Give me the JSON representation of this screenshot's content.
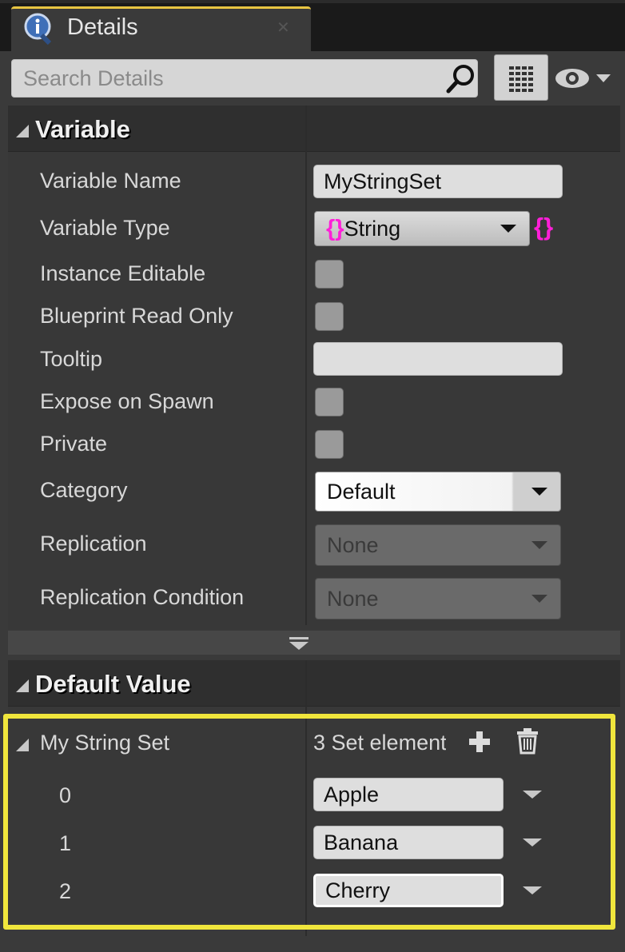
{
  "tab": {
    "title": "Details",
    "icon": "info-icon",
    "close": "✕"
  },
  "search": {
    "placeholder": "Search Details"
  },
  "variable_section": {
    "title": "Variable",
    "rows": {
      "name_label": "Variable Name",
      "name_value": "MyStringSet",
      "type_label": "Variable Type",
      "type_value": "String",
      "type_brace": "{}",
      "instance_editable_label": "Instance Editable",
      "blueprint_read_only_label": "Blueprint Read Only",
      "tooltip_label": "Tooltip",
      "tooltip_value": "",
      "expose_on_spawn_label": "Expose on Spawn",
      "private_label": "Private",
      "category_label": "Category",
      "category_value": "Default",
      "replication_label": "Replication",
      "replication_value": "None",
      "replication_condition_label": "Replication Condition",
      "replication_condition_value": "None"
    }
  },
  "default_value_section": {
    "title": "Default Value",
    "set": {
      "label": "My String Set",
      "count_text": "3 Set element",
      "elements": [
        {
          "index": "0",
          "value": "Apple"
        },
        {
          "index": "1",
          "value": "Banana"
        },
        {
          "index": "2",
          "value": "Cherry"
        }
      ]
    }
  },
  "colors": {
    "accent_tab": "#e8c542",
    "highlight": "#f0e63c",
    "string_pin": "#ff1fd8"
  }
}
